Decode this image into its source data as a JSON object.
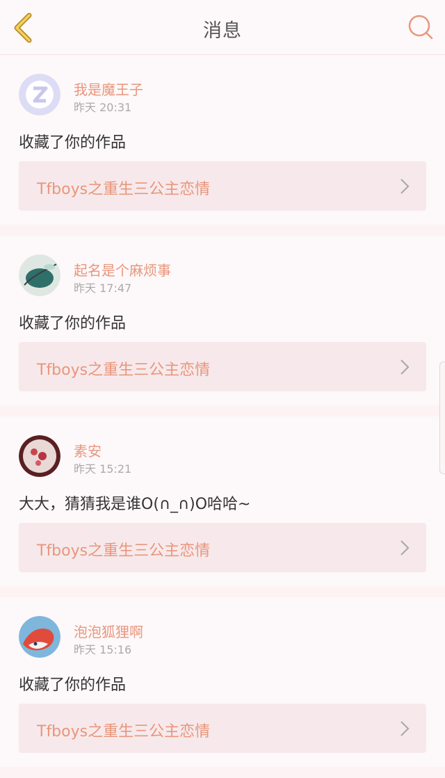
{
  "header": {
    "title": "消息"
  },
  "messages": [
    {
      "username": "我是魔王子",
      "time": "昨天 20:31",
      "content": "收藏了你的作品",
      "work_title": "Tfboys之重生三公主恋情",
      "avatar": "qq-logo-avatar"
    },
    {
      "username": "起名是个麻烦事",
      "time": "昨天 17:47",
      "content": "收藏了你的作品",
      "work_title": "Tfboys之重生三公主恋情",
      "avatar": "leaf-avatar"
    },
    {
      "username": "素安",
      "time": "昨天 15:21",
      "content": "大大，猜猜我是谁O(∩_∩)O哈哈~",
      "work_title": "Tfboys之重生三公主恋情",
      "avatar": "flower-avatar"
    },
    {
      "username": "泡泡狐狸啊",
      "time": "昨天 15:16",
      "content": "收藏了你的作品",
      "work_title": "Tfboys之重生三公主恋情",
      "avatar": "fox-avatar"
    }
  ],
  "colors": {
    "accent": "#e8967c",
    "background": "#fdf3f5",
    "card": "#fdf8f9",
    "link_bg": "#f7e9eb"
  }
}
